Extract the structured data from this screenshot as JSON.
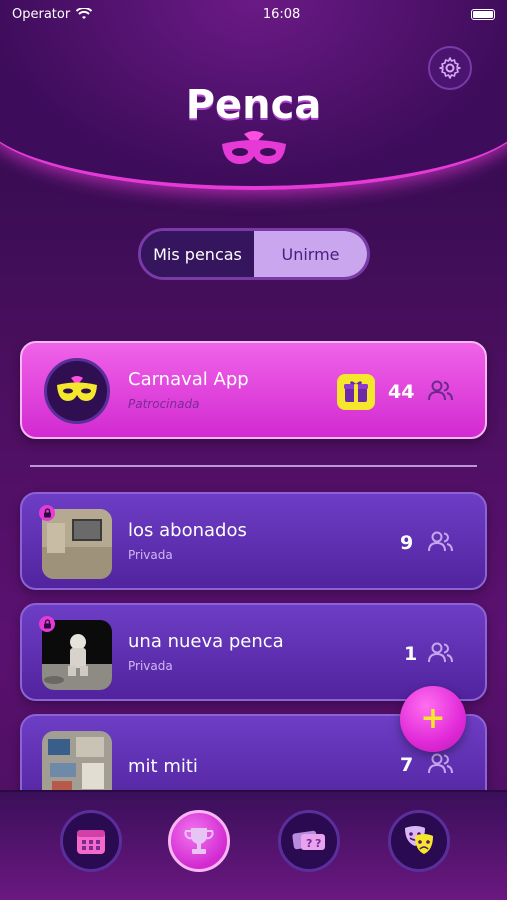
{
  "status": {
    "carrier": "Operator",
    "time": "16:08"
  },
  "header": {
    "title": "Penca"
  },
  "toggle": {
    "options": [
      "Mis pencas",
      "Unirme"
    ],
    "selected": "Mis pencas"
  },
  "pencas": [
    {
      "name": "Carnaval App",
      "type": "Patrocinada",
      "members": "44",
      "gift_icon": "gift-icon"
    },
    {
      "name": "los abonados",
      "type": "Privada",
      "members": "9"
    },
    {
      "name": "una nueva penca",
      "type": "Privada",
      "members": "1"
    },
    {
      "name": "mit miti",
      "type": "",
      "members": "7"
    }
  ],
  "fab": {
    "label": "+"
  },
  "tabs": [
    {
      "icon": "calendar-icon"
    },
    {
      "icon": "trophy-icon"
    },
    {
      "icon": "tickets-icon"
    },
    {
      "icon": "theater-masks-icon"
    }
  ],
  "colors": {
    "accent": "#e53ad6",
    "purple": "#52239e",
    "gold": "#f5e82c"
  }
}
